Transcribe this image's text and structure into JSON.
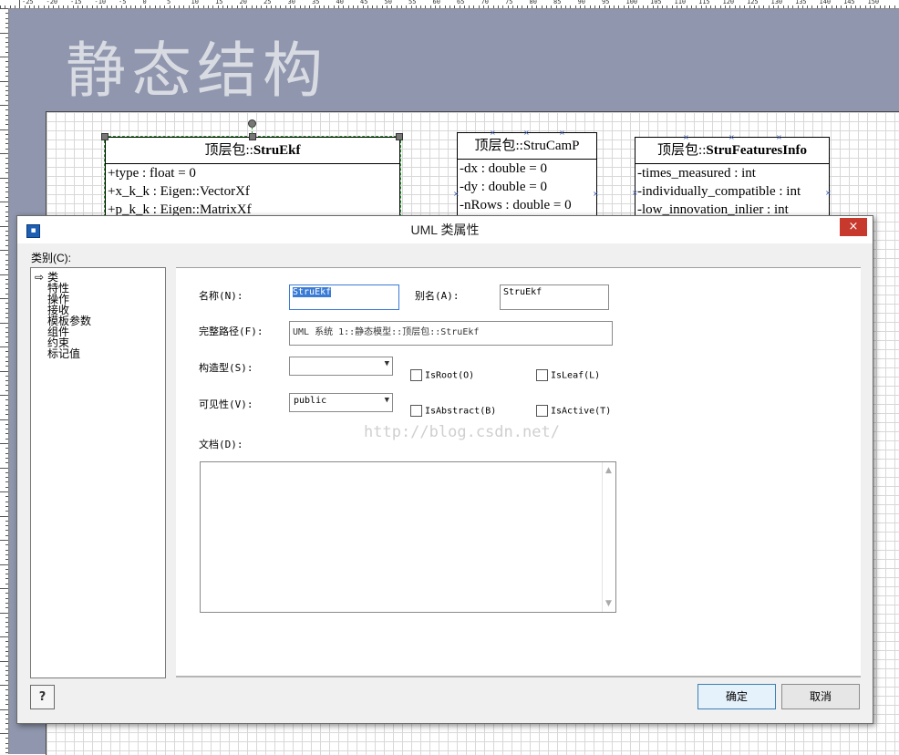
{
  "canvas": {
    "page_title": "静态结构",
    "ruler_numbers": [
      "-25",
      "-20",
      "-15",
      "-10",
      "-5",
      "0",
      "5",
      "10",
      "15",
      "20",
      "25",
      "30",
      "35",
      "40",
      "45",
      "50",
      "55",
      "60",
      "65",
      "70",
      "75",
      "80",
      "85",
      "90",
      "95",
      "100",
      "105",
      "110",
      "115",
      "120",
      "125",
      "130",
      "135",
      "140",
      "145",
      "150"
    ]
  },
  "classes": [
    {
      "package": "顶层包::",
      "name": "StruEkf",
      "attributes": [
        "+type : float = 0",
        "+x_k_k : Eigen::VectorXf",
        "+p_k_k : Eigen::MatrixXf"
      ]
    },
    {
      "package": "顶层包::",
      "name": "StruCamP",
      "attributes": [
        "-dx : double = 0",
        "-dy : double = 0",
        "-nRows : double = 0"
      ]
    },
    {
      "package": "顶层包::",
      "name": "StruFeaturesInfo",
      "attributes": [
        "-times_measured  : int",
        "-individually_compatible : int",
        "-low_innovation_inlier : int"
      ]
    }
  ],
  "dialog": {
    "title": "UML 类属性",
    "close_symbol": "×",
    "category_label": "类别(C):",
    "categories": [
      "类",
      "特性",
      "操作",
      "接收",
      "模板参数",
      "组件",
      "约束",
      "标记值"
    ],
    "fields": {
      "name_label": "名称(N):",
      "name_value": "StruEkf",
      "alias_label": "别名(A):",
      "alias_value": "StruEkf",
      "fullpath_label": "完整路径(F):",
      "fullpath_value": "UML 系统 1::静态模型::顶层包::StruEkf",
      "stereotype_label": "构造型(S):",
      "stereotype_value": "",
      "visibility_label": "可见性(V):",
      "visibility_value": "public",
      "documentation_label": "文档(D):"
    },
    "checkboxes": {
      "is_root": "IsRoot(O)",
      "is_leaf": "IsLeaf(L)",
      "is_abstract": "IsAbstract(B)",
      "is_active": "IsActive(T)"
    },
    "watermark": "http://blog.csdn.net/",
    "help_label": "?",
    "ok_label": "确定",
    "cancel_label": "取消"
  }
}
